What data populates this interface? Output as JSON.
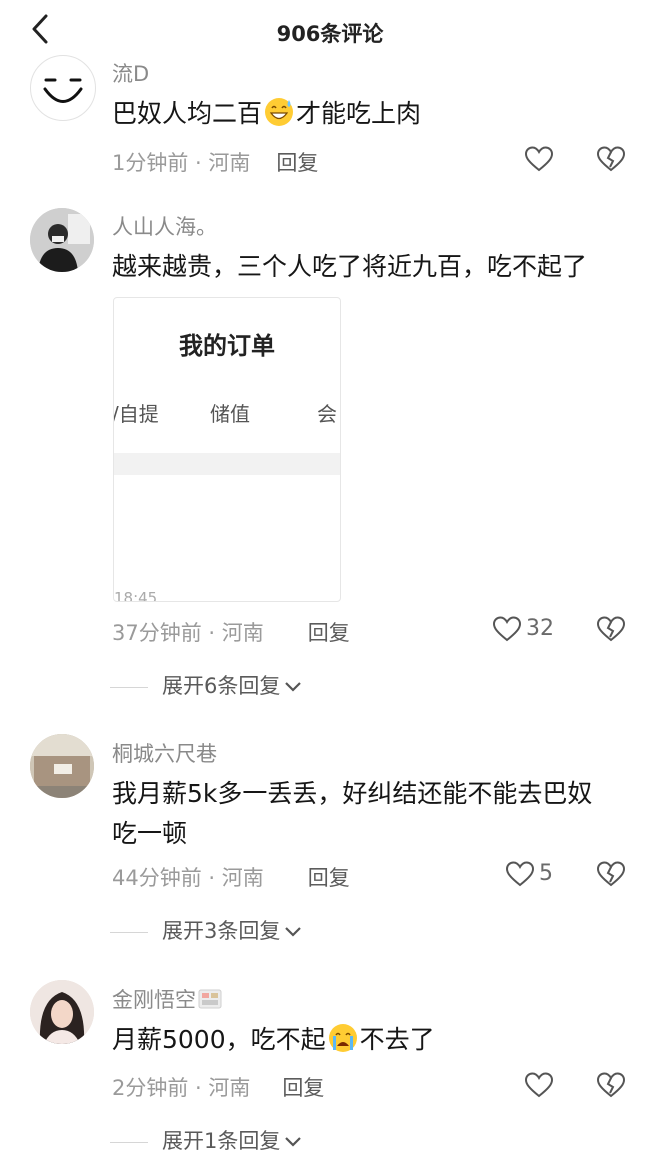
{
  "header": {
    "title": "906条评论"
  },
  "comments": [
    {
      "user": "流D",
      "text_a": "巴奴人均二百",
      "text_b": "才能吃上肉",
      "time": "1分钟前 · 河南",
      "reply": "回复",
      "likes": ""
    },
    {
      "user": "人山人海。",
      "text": "越来越贵，三个人吃了将近九百，吃不起了",
      "time": "37分钟前 · 河南",
      "reply": "回复",
      "likes": "32",
      "expand": "展开6条回复",
      "image": {
        "title": "我的订单",
        "tabs": [
          "/自提",
          "储值",
          "会"
        ],
        "time": "18:45"
      }
    },
    {
      "user": "桐城六尺巷",
      "text": "我月薪5k多一丢丢，好纠结还能不能去巴奴吃一顿",
      "time": "44分钟前 · 河南",
      "reply": "回复",
      "likes": "5",
      "expand": "展开3条回复"
    },
    {
      "user": "金刚悟空",
      "text_a": "月薪5000，吃不起",
      "text_b": "不去了",
      "time": "2分钟前 · 河南",
      "reply": "回复",
      "likes": "",
      "expand": "展开1条回复"
    }
  ],
  "colors": {
    "text": "#161616",
    "meta": "#9a9a9a",
    "username": "#8a8a8a"
  }
}
